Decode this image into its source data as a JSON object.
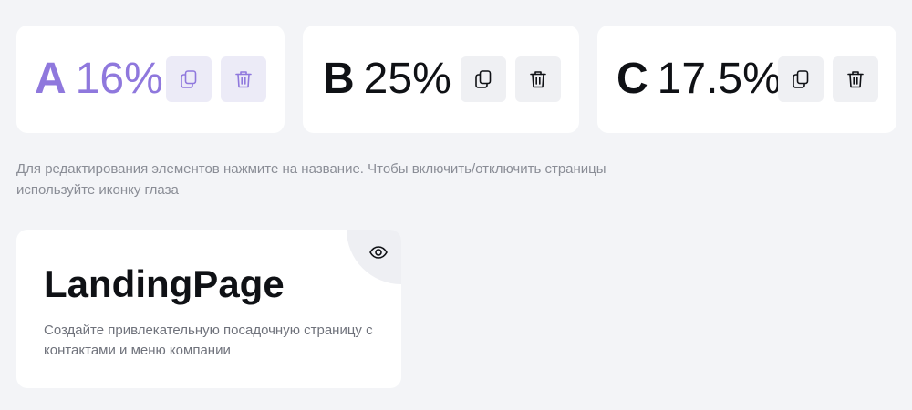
{
  "variants": [
    {
      "letter": "A",
      "percent": "16%",
      "active": true,
      "accent": "#8f78dd"
    },
    {
      "letter": "B",
      "percent": "25%",
      "active": false,
      "accent": "#0f1115"
    },
    {
      "letter": "C",
      "percent": "17.5%",
      "active": false,
      "accent": "#0f1115"
    }
  ],
  "actions": {
    "copy_icon": "copy-icon",
    "delete_icon": "trash-icon"
  },
  "colors": {
    "active_accent": "#8f78dd",
    "active_button_bg": "#ecebf7",
    "button_bg": "#eff0f3",
    "background": "#f3f4f7"
  },
  "hint": "Для редактирования элементов нажмите на название. Чтобы включить/отключить страницы используйте иконку глаза",
  "page": {
    "title": "LandingPage",
    "description": "Создайте привлекательную посадочную страницу с контактами и меню компании",
    "visibility_icon": "eye-icon"
  }
}
